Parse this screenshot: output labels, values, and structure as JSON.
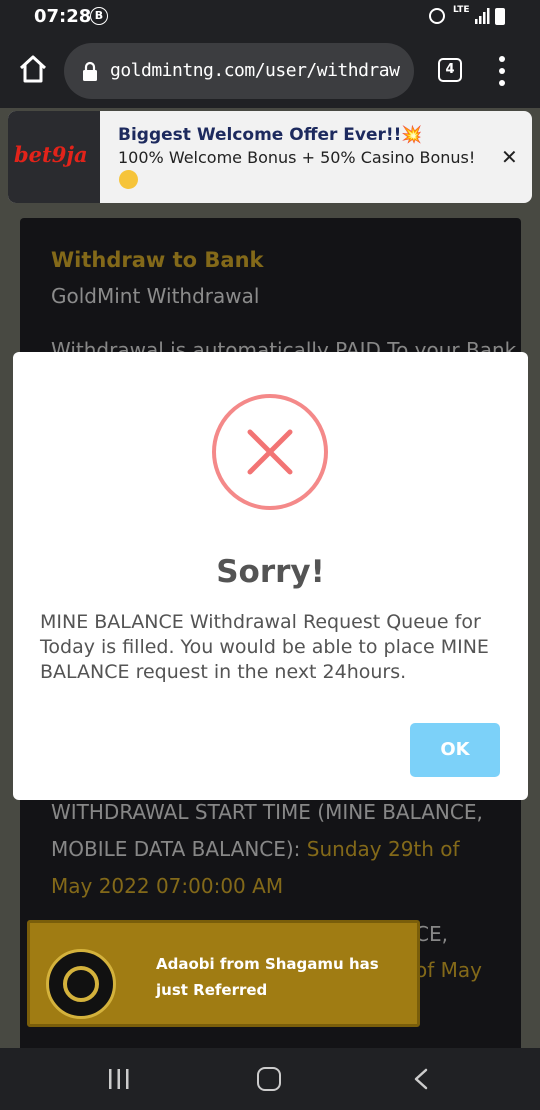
{
  "status_bar": {
    "time": "07:28",
    "b_badge": "B",
    "lte": "LTE",
    "icons": [
      "alarm-icon",
      "signal-icon",
      "battery-icon"
    ]
  },
  "browser": {
    "url": "goldmintng.com/user/withdraw",
    "tab_count": "4"
  },
  "ad": {
    "logo": "bet9ja",
    "title": "Biggest Welcome Offer Ever!!💥",
    "text": "100% Welcome Bonus + 50% Casino Bonus!",
    "close": "✕"
  },
  "page": {
    "title": "Withdraw to Bank",
    "subtitle": "GoldMint Withdrawal",
    "desc": "Withdrawal is automatically PAID To your Bank",
    "start_time_label": "WITHDRAWAL START TIME (MINE BALANCE, MOBILE DATA BALANCE): ",
    "start_time_value": "Sunday 29th of May 2022 07:00:00 AM",
    "clip_line_1": "CE,",
    "clip_line_2": "of May"
  },
  "modal": {
    "title": "Sorry!",
    "message": "MINE BALANCE Withdrawal Request Queue for Today is filled. You would be able to place MINE BALANCE request in the next 24hours.",
    "ok_label": "OK"
  },
  "notification": {
    "text": "Adaobi from Shagamu has just Referred"
  },
  "colors": {
    "accent_gold": "#c9a227",
    "error_red": "#f27474",
    "ok_button": "#7cd1f9",
    "toast_bg": "#a07c13"
  }
}
